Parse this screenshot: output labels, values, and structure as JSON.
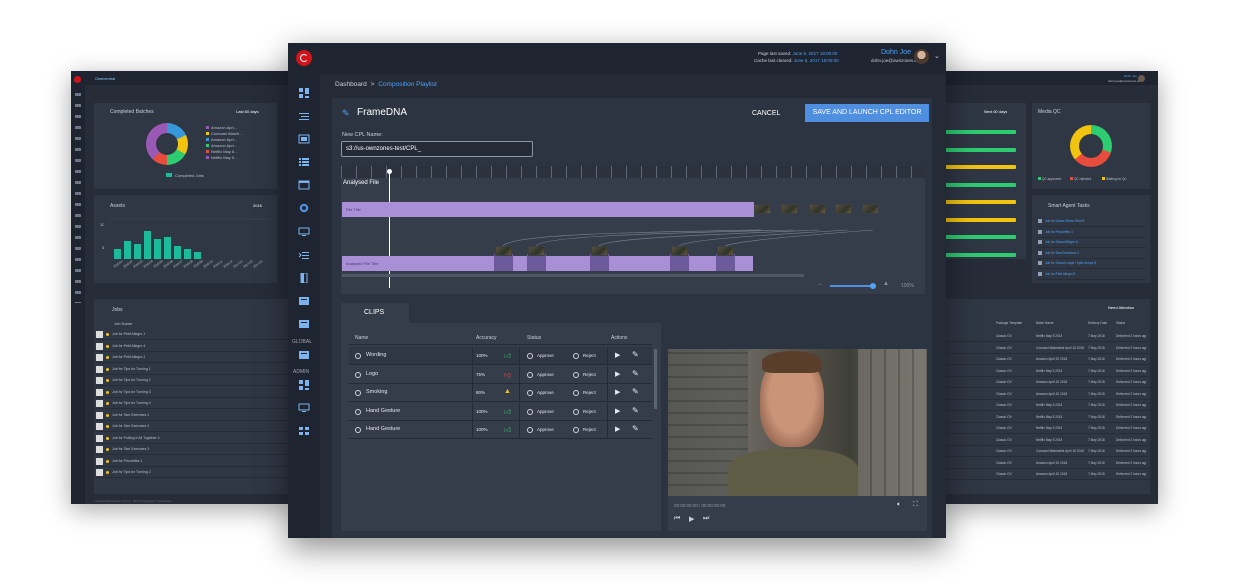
{
  "left_window": {
    "brand": "Owncentral",
    "completed_batches": {
      "title": "Completed Batches",
      "filter": "Last 60 days",
      "legend": [
        "Amazon Aprl…",
        "Comcast Watch…",
        "Amazon Aprl…",
        "Amazon Aprl…",
        "Netflix May 5…",
        "Netflix May 5…"
      ],
      "legend_colors": [
        "#9b59b6",
        "#f1c40f",
        "#3498db",
        "#2ecc71",
        "#e74c3c",
        "#9b59b6"
      ],
      "badge": "Completed Jobs"
    },
    "assets": {
      "title": "Assets",
      "filter": "2016",
      "ylabels": [
        "10",
        "5"
      ],
      "bars": [
        1,
        1.8,
        1.5,
        2.8,
        2,
        2.2,
        1.3,
        1.0,
        0.7,
        0,
        0,
        0,
        0,
        0,
        0
      ],
      "xlabels": [
        "2016-01",
        "2016-02",
        "2016-03",
        "2016-04",
        "2016-05",
        "2016-06",
        "2016-07",
        "2016-08",
        "2016-09",
        "2016-10",
        "2016-11",
        "2016-12",
        "2017-01",
        "2017-02",
        "2017-03"
      ]
    },
    "jobs": {
      "title": "Jobs",
      "column": "Job Name",
      "rows": [
        "Job for Petit Allegro 1",
        "Job for Petit Allegro 4",
        "Job for Petit Allegro 2",
        "Job for Tips for Turning 1",
        "Job for Tips for Turning 2",
        "Job for Tips for Turning 3",
        "Job for Tips for Turning 4",
        "Job for Tam Exercises 1",
        "Job for Tam Exercises 2",
        "Job for Putting It All Together 4",
        "Job for Tam Exercises 3",
        "Job for Pirouettes 1",
        "Job for Tips for Turning 2"
      ],
      "footer": "Owncentral Version 2.21.5 · 2017 Copyright © OwnZones"
    }
  },
  "right_window": {
    "user": "Dohn Joe",
    "email": "dohn.joe@ownzones.com",
    "filter": "Next 60 days",
    "bars": [
      {
        "color": "#2ecc71",
        "value": 1.0
      },
      {
        "color": "#2ecc71",
        "value": 1.0
      },
      {
        "color": "#f1c40f",
        "value": 1.0
      },
      {
        "color": "#2ecc71",
        "value": 1.0
      },
      {
        "color": "#f1c40f",
        "value": 1.0
      },
      {
        "color": "#f1c40f",
        "value": 1.0
      },
      {
        "color": "#2ecc71",
        "value": 1.0
      },
      {
        "color": "#2ecc71",
        "value": 1.0
      }
    ],
    "media_qc": {
      "title": "Media QC",
      "legend": [
        "QC approved",
        "QC rejected",
        "Waiting for QC"
      ],
      "colors": [
        "#2ecc71",
        "#e74c3c",
        "#f1c40f"
      ]
    },
    "smart_tasks": {
      "title": "Smart Agent Tasks",
      "items": [
        "Job for Dance Demo Reel 8",
        "Job for Pirouettes 4",
        "Job for Grand Allegro 8",
        "Job for Tam Exercises 2",
        "Job for Grand Leaps / Split Jumps 8",
        "Job for Petit Allegro 8"
      ]
    },
    "need_attention": "Need Attention",
    "columns": [
      "Package Template",
      "Batch Name",
      "Delivery Date",
      "Status"
    ],
    "rows": [
      [
        "Classic OV",
        "Netflix May 5 2018",
        "7 May 2018",
        "Delivered 2 hours ago"
      ],
      [
        "Classic OV",
        "Comcast Watchable April 16 2018",
        "7 May 2018",
        "Delivered 2 hours ago"
      ],
      [
        "Classic OV",
        "Amazon April 20 2018",
        "7 May 2018",
        "Delivered 2 hours ago"
      ],
      [
        "Classic OV",
        "Netflix May 5 2018",
        "7 May 2018",
        "Delivered 2 hours ago"
      ],
      [
        "Classic OV",
        "Amazon April 20 2018",
        "7 May 2018",
        "Delivered 2 hours ago"
      ],
      [
        "Classic OV",
        "Amazon April 20 2018",
        "7 May 2018",
        "Delivered 2 hours ago"
      ],
      [
        "Classic OV",
        "Netflix May 5 2018",
        "7 May 2018",
        "Delivered 2 hours ago"
      ],
      [
        "Classic OV",
        "Netflix May 5 2018",
        "7 May 2018",
        "Delivered 2 hours ago"
      ],
      [
        "Classic OV",
        "Netflix May 5 2018",
        "7 May 2018",
        "Delivered 2 hours ago"
      ],
      [
        "Classic OV",
        "Netflix May 5 2018",
        "7 May 2018",
        "Delivered 2 hours ago"
      ],
      [
        "Classic OV",
        "Comcast Watchable April 16 2018",
        "7 May 2018",
        "Delivered 2 hours ago"
      ],
      [
        "Classic OV",
        "Amazon April 20 2018",
        "7 May 2018",
        "Delivered 2 hours ago"
      ],
      [
        "Classic OV",
        "Amazon April 20 2018",
        "7 May 2018",
        "Delivered 2 hours ago"
      ]
    ]
  },
  "main": {
    "topbar": {
      "page_last_saved_label": "Page last saved:",
      "page_last_saved_value": "June 5, 2017 18:00:00",
      "cache_cleared_label": "Cache last cleared:",
      "cache_cleared_value": "June 5, 2017 18:00:00",
      "user_name": "Dohn Joe",
      "user_email": "dohn.joe@ownzones.com"
    },
    "breadcrumb": {
      "root": "Dashboard",
      "separator": ">",
      "current": "Composition Playlist"
    },
    "title": "FrameDNA",
    "cancel": "CANCEL",
    "save": "SAVE AND LAUNCH CPL EDITOR",
    "cpl_label": "New CPL Name:",
    "cpl_value": "s3://us-ownzones-test/CPL_",
    "sidebar_sections": [
      "GLOBAL",
      "ADMIN"
    ],
    "timeline": {
      "analysed_file": "Analysed File",
      "track1": "File Title",
      "track2": "Analysed File Title",
      "zoom": "100%"
    },
    "clips": {
      "tab": "CLIPS",
      "columns": [
        "Name",
        "Accuracy",
        "Status",
        "Actions"
      ],
      "approve": "Approve",
      "reject": "Reject",
      "rows": [
        {
          "name": "Wording",
          "accuracy": "100%",
          "icon": "thumbs-up"
        },
        {
          "name": "Logo",
          "accuracy": "75%",
          "icon": "thumbs-down"
        },
        {
          "name": "Smoking",
          "accuracy": "80%",
          "icon": "warning"
        },
        {
          "name": "Hand Gesture",
          "accuracy": "100%",
          "icon": "thumbs-up"
        },
        {
          "name": "Hand Gesture",
          "accuracy": "100%",
          "icon": "thumbs-up"
        }
      ]
    },
    "player": {
      "timecode": "00:00:00:00 / 00:00:00:00"
    }
  }
}
